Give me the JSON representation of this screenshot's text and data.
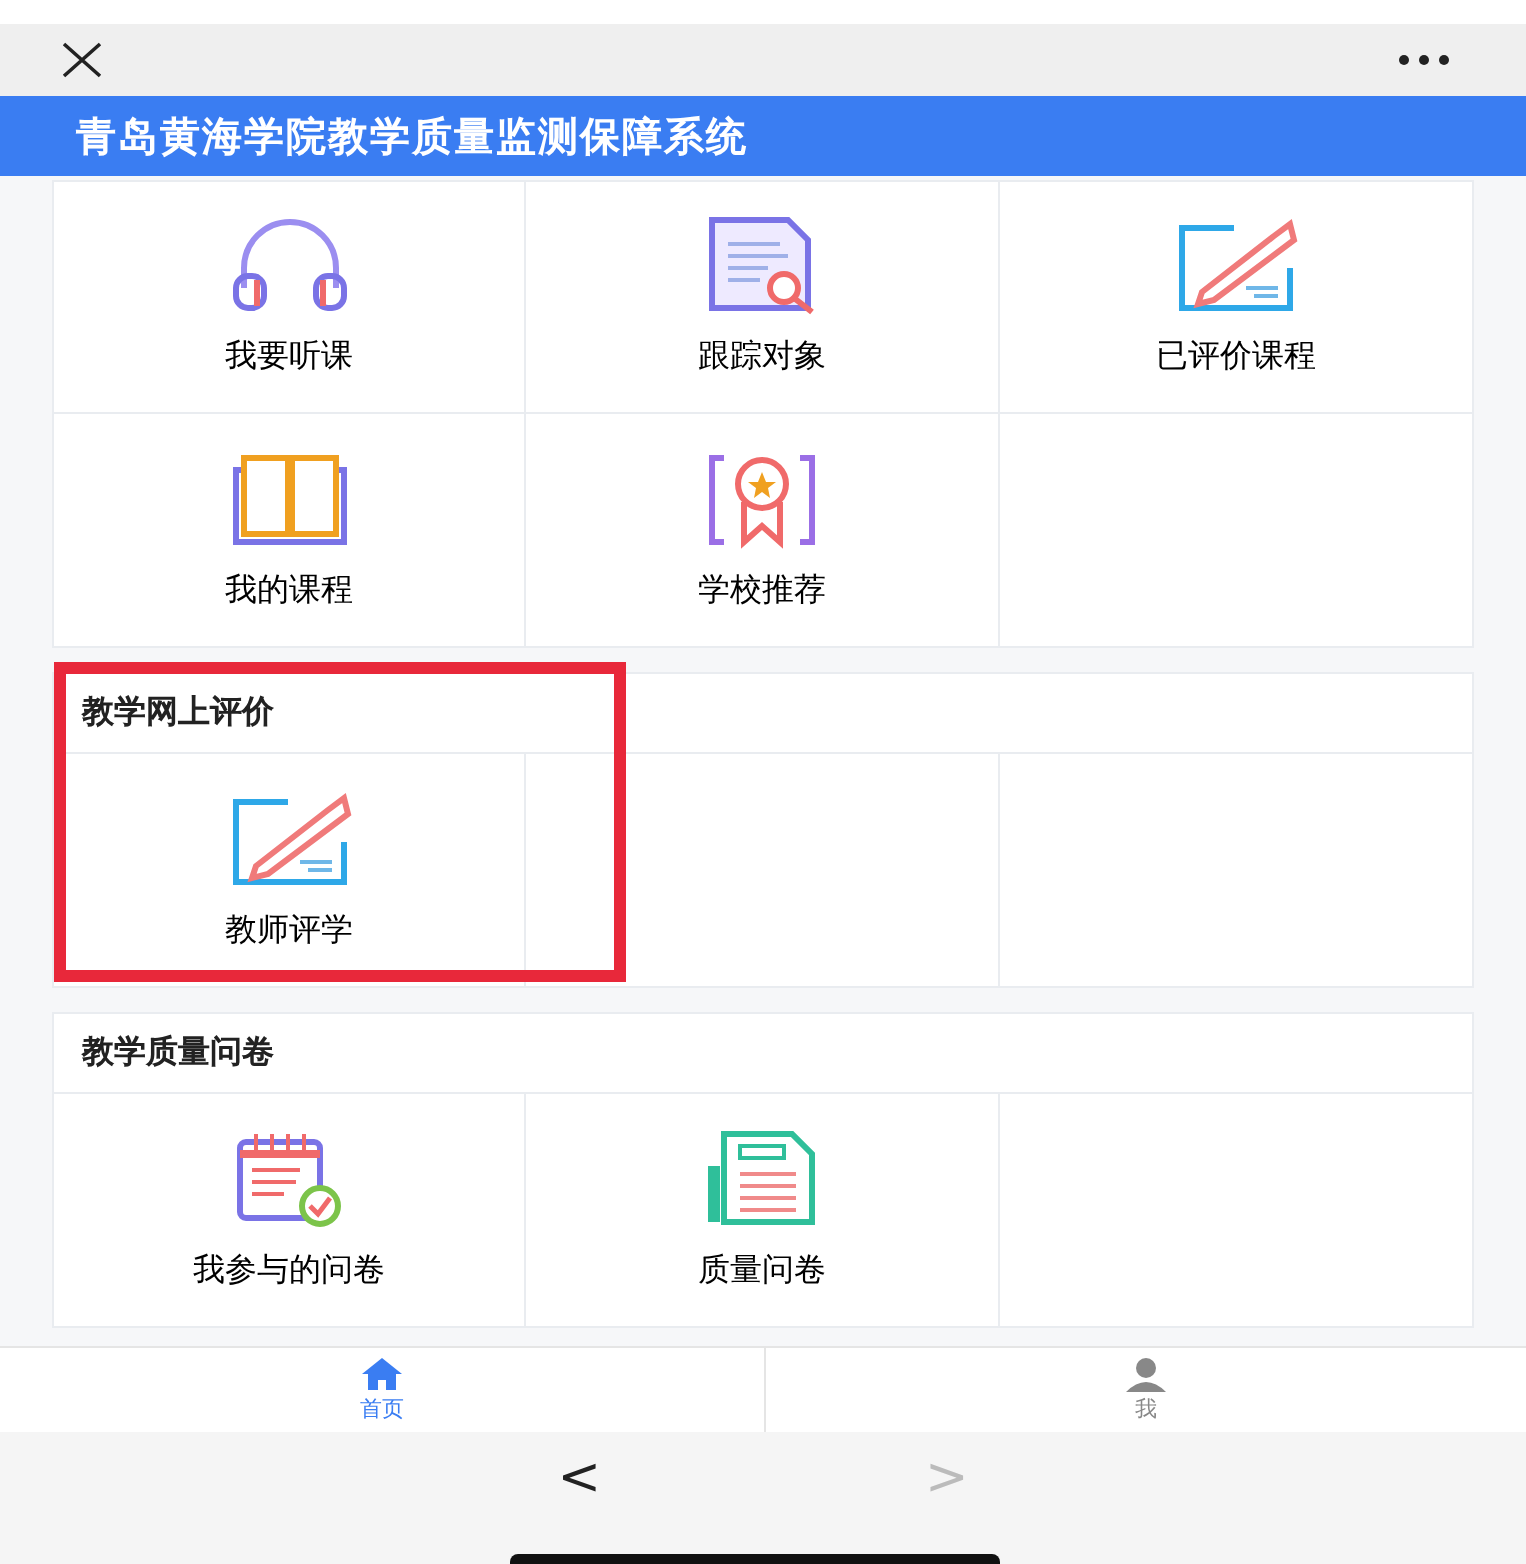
{
  "header": {
    "title": "青岛黄海学院教学质量监测保障系统"
  },
  "sections": [
    {
      "items": [
        {
          "label": "我要听课"
        },
        {
          "label": "跟踪对象"
        },
        {
          "label": "已评价课程"
        },
        {
          "label": "我的课程"
        },
        {
          "label": "学校推荐"
        }
      ]
    },
    {
      "title": "教学网上评价",
      "highlighted": true,
      "items": [
        {
          "label": "教师评学"
        }
      ]
    },
    {
      "title": "教学质量问卷",
      "highlighted": false,
      "items": [
        {
          "label": "我参与的问卷"
        },
        {
          "label": "质量问卷"
        }
      ]
    }
  ],
  "tab_bar": [
    {
      "label": "首页",
      "selected": true
    },
    {
      "label": "我",
      "selected": false
    }
  ],
  "nav": {
    "back": {
      "label": "<",
      "disabled": false
    },
    "forward": {
      "label": ">",
      "disabled": true
    }
  }
}
